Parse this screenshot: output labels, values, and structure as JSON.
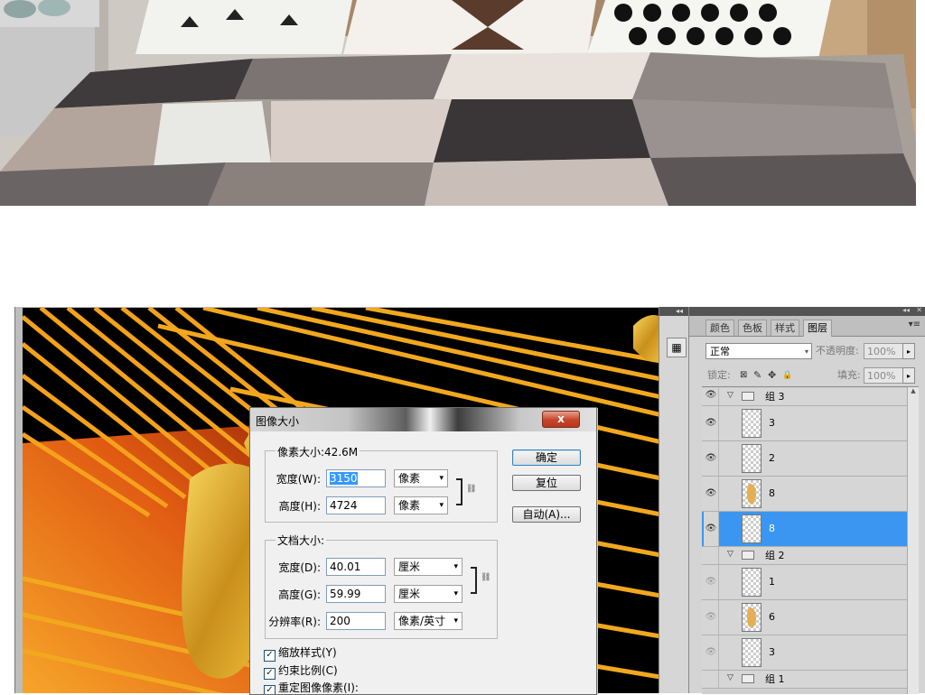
{
  "dialog": {
    "title": "图像大小",
    "close": "x",
    "pixel_dims": {
      "legend": "像素大小:42.6M",
      "width_label": "宽度(W):",
      "width_value": "3150",
      "width_unit": "像素",
      "height_label": "高度(H):",
      "height_value": "4724",
      "height_unit": "像素"
    },
    "doc_size": {
      "legend": "文档大小:",
      "width_label": "宽度(D):",
      "width_value": "40.01",
      "width_unit": "厘米",
      "height_label": "高度(G):",
      "height_value": "59.99",
      "height_unit": "厘米",
      "res_label": "分辨率(R):",
      "res_value": "200",
      "res_unit": "像素/英寸"
    },
    "buttons": {
      "ok": "确定",
      "reset": "复位",
      "auto": "自动(A)..."
    },
    "checks": {
      "scale_styles": "缩放样式(Y)",
      "constrain": "约束比例(C)",
      "resample": "重定图像像素(I):"
    },
    "check_mark": "✓"
  },
  "panel": {
    "tabs": [
      "颜色",
      "色板",
      "样式",
      "图层"
    ],
    "active_tab": "图层",
    "blend_mode": "正常",
    "opacity_label": "不透明度:",
    "opacity_value": "100%",
    "lock_label": "锁定:",
    "fill_label": "填充:",
    "fill_value": "100%",
    "layers": [
      {
        "kind": "group",
        "name": "组 3",
        "visible": true
      },
      {
        "kind": "layer",
        "name": "3",
        "visible": true,
        "thumb": "blank"
      },
      {
        "kind": "layer",
        "name": "2",
        "visible": true,
        "thumb": "blank"
      },
      {
        "kind": "layer",
        "name": "8",
        "visible": true,
        "thumb": "gold"
      },
      {
        "kind": "layer",
        "name": "8",
        "visible": true,
        "thumb": "blank",
        "selected": true
      },
      {
        "kind": "group",
        "name": "组 2",
        "visible": false
      },
      {
        "kind": "layer",
        "name": "1",
        "visible": false,
        "thumb": "blank"
      },
      {
        "kind": "layer",
        "name": "6",
        "visible": false,
        "thumb": "gold"
      },
      {
        "kind": "layer",
        "name": "3",
        "visible": false,
        "thumb": "blank"
      },
      {
        "kind": "group",
        "name": "组 1",
        "visible": false
      }
    ]
  },
  "icons": {
    "eye": "👁",
    "expand": "▽",
    "dropdown": "▾",
    "chain": "⛓",
    "lock": "🔒",
    "move": "✥",
    "brush": "✎",
    "panel_menu": "▾≡",
    "collapse": "◂◂",
    "close": "✕"
  },
  "colors": {
    "selection": "#3b96f2",
    "canvas_bg": "#000000",
    "gold": "#f5a623"
  }
}
